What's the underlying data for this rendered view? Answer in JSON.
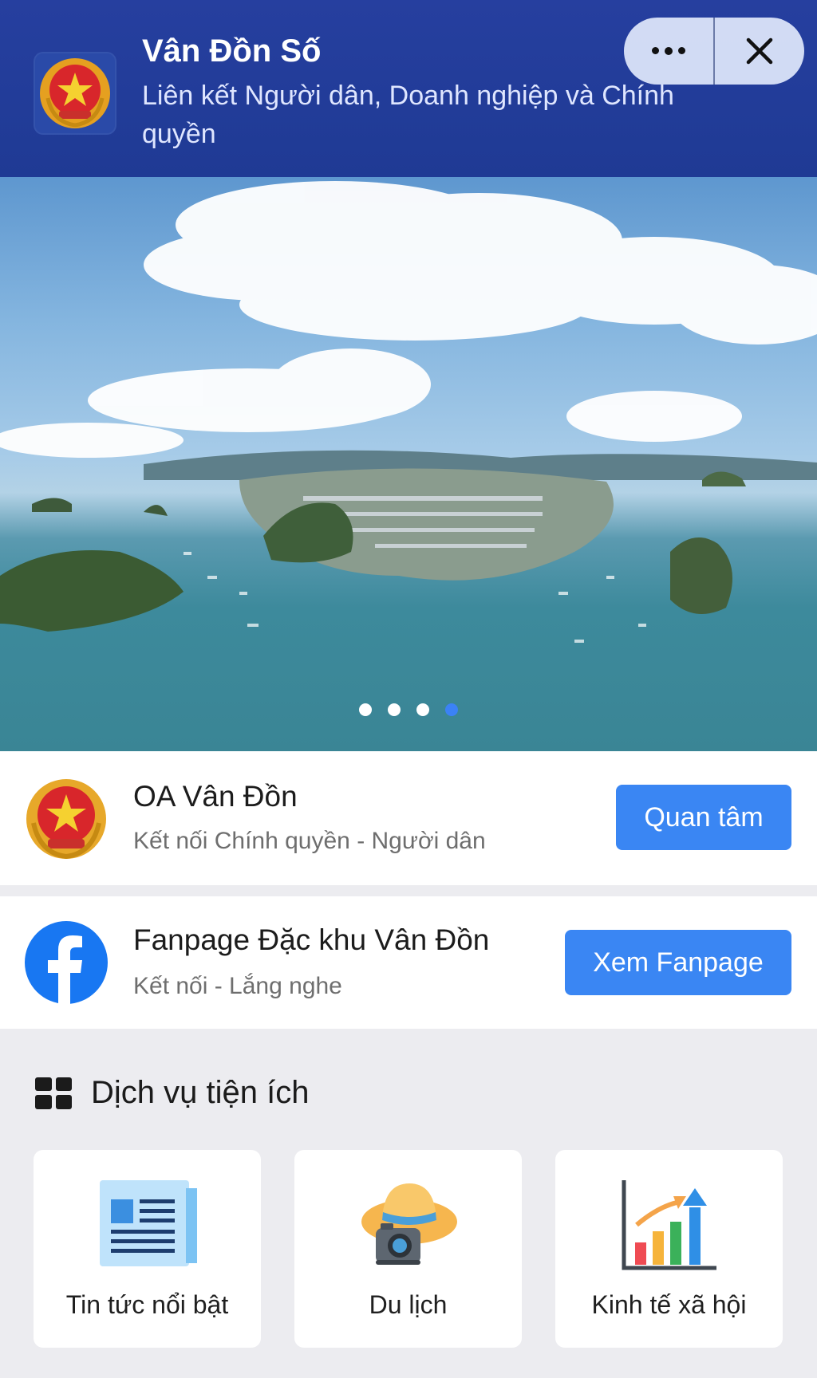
{
  "header": {
    "title": "Vân Đồn Số",
    "subtitle": "Liên kết Người dân, Doanh nghiệp và Chính quyền",
    "logo_icon": "vietnam-emblem-icon",
    "more_icon": "more-dots-icon",
    "close_icon": "close-icon"
  },
  "banner": {
    "pages": 4,
    "active_page": 4
  },
  "oa": {
    "title": "OA Vân Đồn",
    "subtitle": "Kết nối Chính quyền - Người dân",
    "button": "Quan tâm"
  },
  "fanpage": {
    "title": "Fanpage Đặc khu Vân Đồn",
    "subtitle": "Kết nối - Lắng nghe",
    "button": "Xem Fanpage"
  },
  "services": {
    "title": "Dịch vụ tiện ích",
    "items": [
      {
        "label": "Tin tức nổi bật",
        "icon": "newspaper-icon"
      },
      {
        "label": "Du lịch",
        "icon": "travel-hat-camera-icon"
      },
      {
        "label": "Kinh tế xã hội",
        "icon": "growth-chart-icon"
      }
    ]
  },
  "colors": {
    "header_bg": "#1f3a94",
    "primary_button": "#3a86f3",
    "facebook_blue": "#1877f2"
  }
}
